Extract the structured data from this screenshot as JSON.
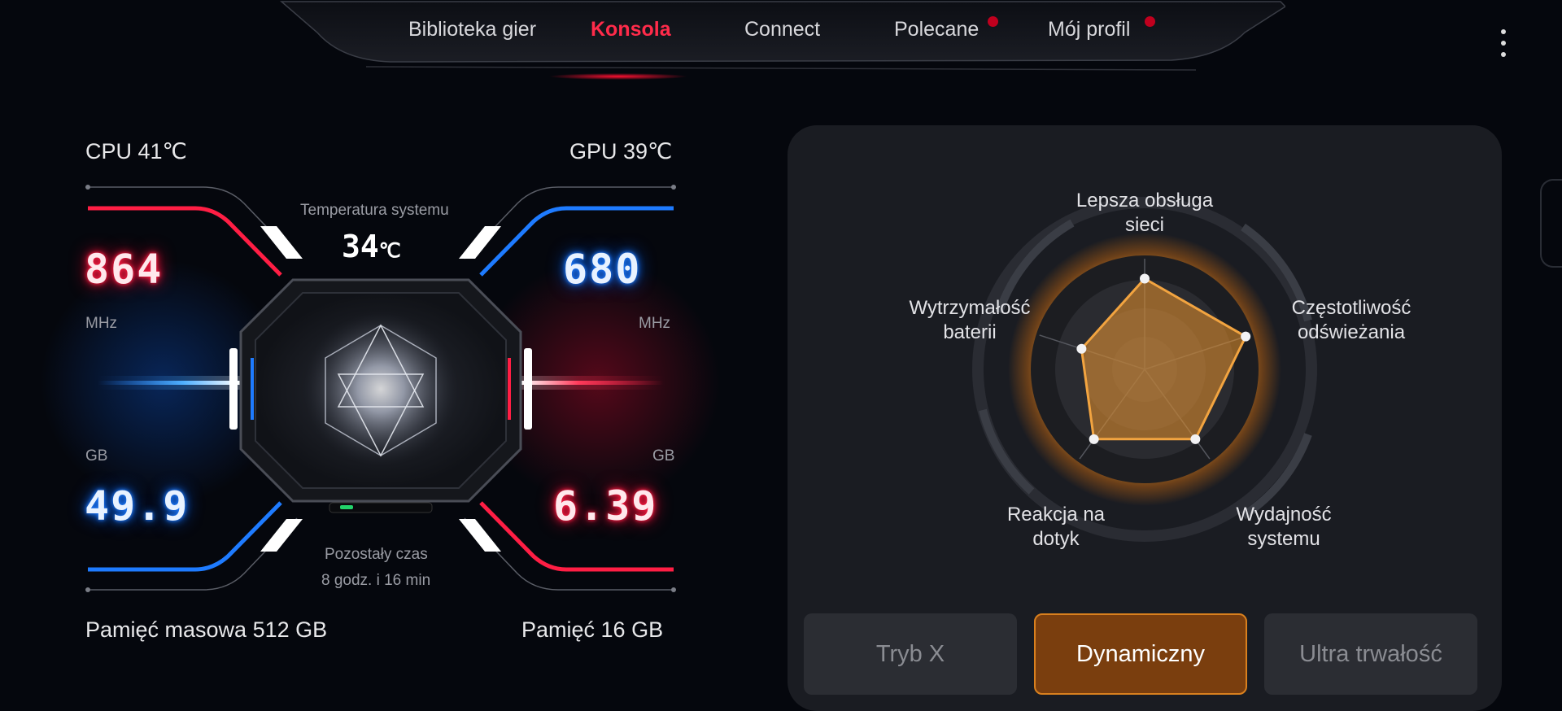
{
  "nav": {
    "tabs": [
      {
        "label": "Biblioteka gier",
        "active": false,
        "badge": false
      },
      {
        "label": "Konsola",
        "active": true,
        "badge": false
      },
      {
        "label": "Connect",
        "active": false,
        "badge": false
      },
      {
        "label": "Polecane",
        "active": false,
        "badge": true
      },
      {
        "label": "Mój profil",
        "active": false,
        "badge": true
      }
    ],
    "menu_icon": "more-vertical-icon"
  },
  "monitor": {
    "cpu_label": "CPU  41℃",
    "gpu_label": "GPU  39℃",
    "system_temp_label": "Temperatura systemu",
    "system_temp_value": "34",
    "system_temp_unit": "℃",
    "cpu_freq": "864",
    "cpu_freq_unit": "MHz",
    "gpu_freq": "680",
    "gpu_freq_unit": "MHz",
    "storage_free": "49.9",
    "storage_unit": "GB",
    "ram_free": "6.39",
    "ram_unit": "GB",
    "remaining_label": "Pozostały czas",
    "remaining_value": "8 godz. i 16 min",
    "storage_label": "Pamięć masowa  512 GB",
    "memory_label": "Pamięć  16 GB"
  },
  "radar": {
    "axes": [
      {
        "label": "Lepsza obsługa\nsieci",
        "value": 0.82
      },
      {
        "label": "Częstotliwość\nodświeżania",
        "value": 0.96
      },
      {
        "label": "Wydajność\nsystemu",
        "value": 0.78
      },
      {
        "label": "Reakcja na\ndotyk",
        "value": 0.78
      },
      {
        "label": "Wytrzymałość\nbaterii",
        "value": 0.6
      }
    ],
    "accent": "#e8922c"
  },
  "modes": [
    {
      "label": "Tryb X",
      "active": false
    },
    {
      "label": "Dynamiczny",
      "active": true
    },
    {
      "label": "Ultra trwałość",
      "active": false
    }
  ]
}
